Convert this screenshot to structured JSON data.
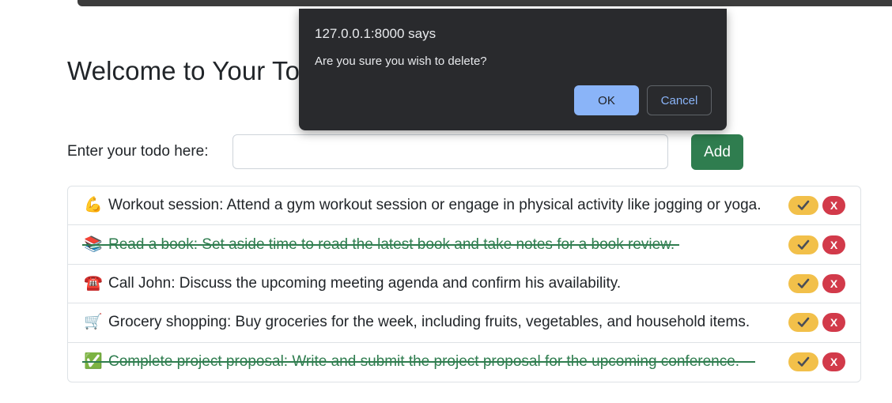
{
  "page": {
    "title": "Welcome to Your Todo List",
    "form_label": "Enter your todo here:",
    "input_value": "",
    "add_label": "Add"
  },
  "todos": [
    {
      "emoji": "💪",
      "icon": "flexed-biceps-icon",
      "text": "Workout session: Attend a gym workout session or engage in physical activity like jogging or yoga.",
      "done": false
    },
    {
      "emoji": "📚",
      "icon": "books-icon",
      "text": "Read a book: Set aside time to read the latest book and take notes for a book review.",
      "done": true
    },
    {
      "emoji": "☎️",
      "icon": "telephone-icon",
      "text": "Call John: Discuss the upcoming meeting agenda and confirm his availability.",
      "done": false
    },
    {
      "emoji": "🛒",
      "icon": "shopping-cart-icon",
      "text": "Grocery shopping: Buy groceries for the week, including fruits, vegetables, and household items.",
      "done": false
    },
    {
      "emoji": "✅",
      "icon": "check-mark-icon",
      "text": "Complete project proposal: Write and submit the project proposal for the upcoming conference.",
      "done": true
    }
  ],
  "buttons": {
    "complete_icon": "check-icon",
    "delete_label": "X"
  },
  "dialog": {
    "origin": "127.0.0.1:8000 says",
    "message": "Are you sure you wish to delete?",
    "ok_label": "OK",
    "cancel_label": "Cancel"
  },
  "colors": {
    "primary_green": "#2f7d4f",
    "warning_yellow": "#f2c04a",
    "danger_red": "#d23a4a",
    "dialog_bg": "#292a2d",
    "dialog_accent": "#8ab4f8"
  }
}
